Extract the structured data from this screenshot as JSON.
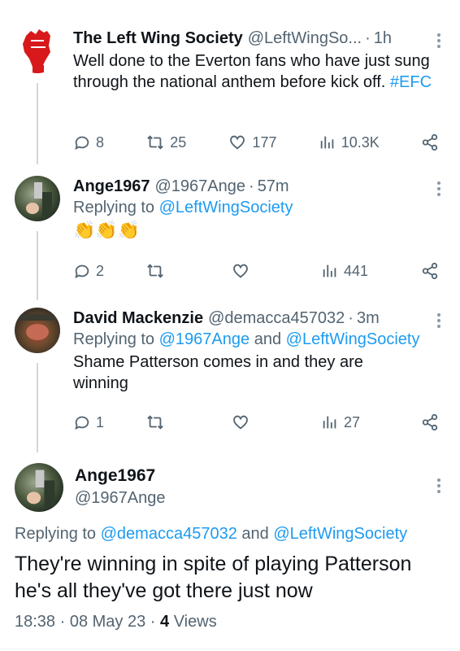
{
  "tweet1": {
    "name": "The Left Wing Society",
    "handle": "@LeftWingSo...",
    "time": "1h",
    "text": "Well done to the Everton fans who have just sung through the national anthem before kick off.",
    "hashtag": "#EFC",
    "replies": "8",
    "retweets": "25",
    "likes": "177",
    "views": "10.3K"
  },
  "tweet2": {
    "name": "Ange1967",
    "handle": "@1967Ange",
    "time": "57m",
    "replying_prefix": "Replying to",
    "replying_to": "@LeftWingSociety",
    "text": "👏👏👏",
    "replies": "2",
    "retweets": "",
    "likes": "",
    "views": "441"
  },
  "tweet3": {
    "name": "David Mackenzie",
    "handle": "@demacca457032",
    "time": "3m",
    "replying_prefix": "Replying to",
    "replying_to_1": "@1967Ange",
    "replying_and": "and",
    "replying_to_2": "@LeftWingSociety",
    "text": "Shame Patterson comes in and they are winning",
    "replies": "1",
    "retweets": "",
    "likes": "",
    "views": "27"
  },
  "main": {
    "name": "Ange1967",
    "handle": "@1967Ange",
    "replying_prefix": "Replying to",
    "replying_to_1": "@demacca457032",
    "replying_and": "and",
    "replying_to_2": "@LeftWingSociety",
    "text": "They're winning in spite of playing Patterson he's all they've got there just now",
    "time": "18:38",
    "date": "08 May 23",
    "views_count": "4",
    "views_label": "Views"
  },
  "colors": {
    "accent": "#1d9bf0",
    "secondary_text": "#536471",
    "logo_red": "#d7191c"
  },
  "icons": [
    "raised-fist-logo-icon",
    "reply-icon",
    "retweet-icon",
    "like-icon",
    "views-icon",
    "share-icon",
    "more-icon"
  ]
}
